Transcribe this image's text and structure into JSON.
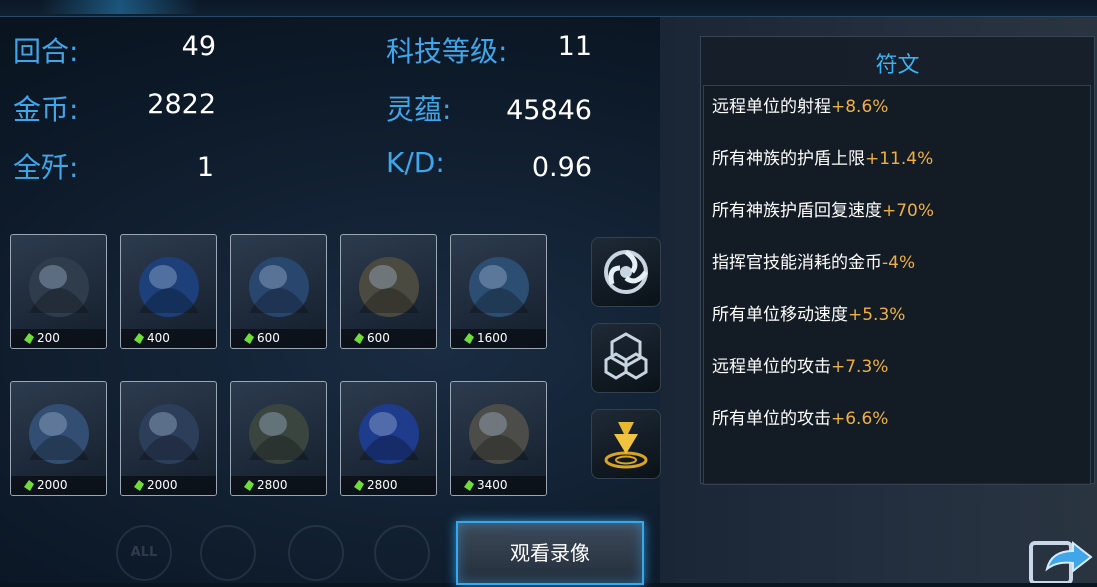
{
  "stats": {
    "round_label": "回合:",
    "round_value": "49",
    "gold_label": "金币:",
    "gold_value": "2822",
    "kills_label": "全歼:",
    "kills_value": "1",
    "tech_label": "科技等级:",
    "tech_value": "11",
    "spirit_label": "灵蕴:",
    "spirit_value": "45846",
    "kd_label": "K/D:",
    "kd_value": "0.96"
  },
  "units": [
    {
      "name": "unit-1",
      "cost": "200",
      "color": "#2e3c4c"
    },
    {
      "name": "unit-2",
      "cost": "400",
      "color": "#1d3f7a"
    },
    {
      "name": "unit-3",
      "cost": "600",
      "color": "#28466e"
    },
    {
      "name": "unit-4",
      "cost": "600",
      "color": "#4a4a40"
    },
    {
      "name": "unit-5",
      "cost": "1600",
      "color": "#2b4e72"
    },
    {
      "name": "unit-6",
      "cost": "2000",
      "color": "#324e72"
    },
    {
      "name": "unit-7",
      "cost": "2000",
      "color": "#2c3e5a"
    },
    {
      "name": "unit-8",
      "cost": "2800",
      "color": "#3a4540"
    },
    {
      "name": "unit-9",
      "cost": "2800",
      "color": "#1e3b8c"
    },
    {
      "name": "unit-10",
      "cost": "3400",
      "color": "#4c4c48"
    }
  ],
  "skills": [
    "swirl-skill-icon",
    "hexagon-shield-skill-icon",
    "drop-target-skill-icon"
  ],
  "runes": {
    "title": "符文",
    "items": [
      {
        "text": "远程单位的射程",
        "bonus": "+8.6%"
      },
      {
        "text": "所有神族的护盾上限",
        "bonus": "+11.4%"
      },
      {
        "text": "所有神族护盾回复速度",
        "bonus": "+70%"
      },
      {
        "text": "指挥官技能消耗的金币",
        "bonus": "-4%"
      },
      {
        "text": "所有单位移动速度",
        "bonus": "+5.3%"
      },
      {
        "text": "远程单位的攻击",
        "bonus": "+7.3%"
      },
      {
        "text": "所有单位的攻击",
        "bonus": "+6.6%"
      }
    ]
  },
  "watch_button": "观看录像",
  "colors": {
    "accent": "#3fa6ea",
    "bonus": "#f0b040",
    "gem": "#6fdc3a"
  }
}
